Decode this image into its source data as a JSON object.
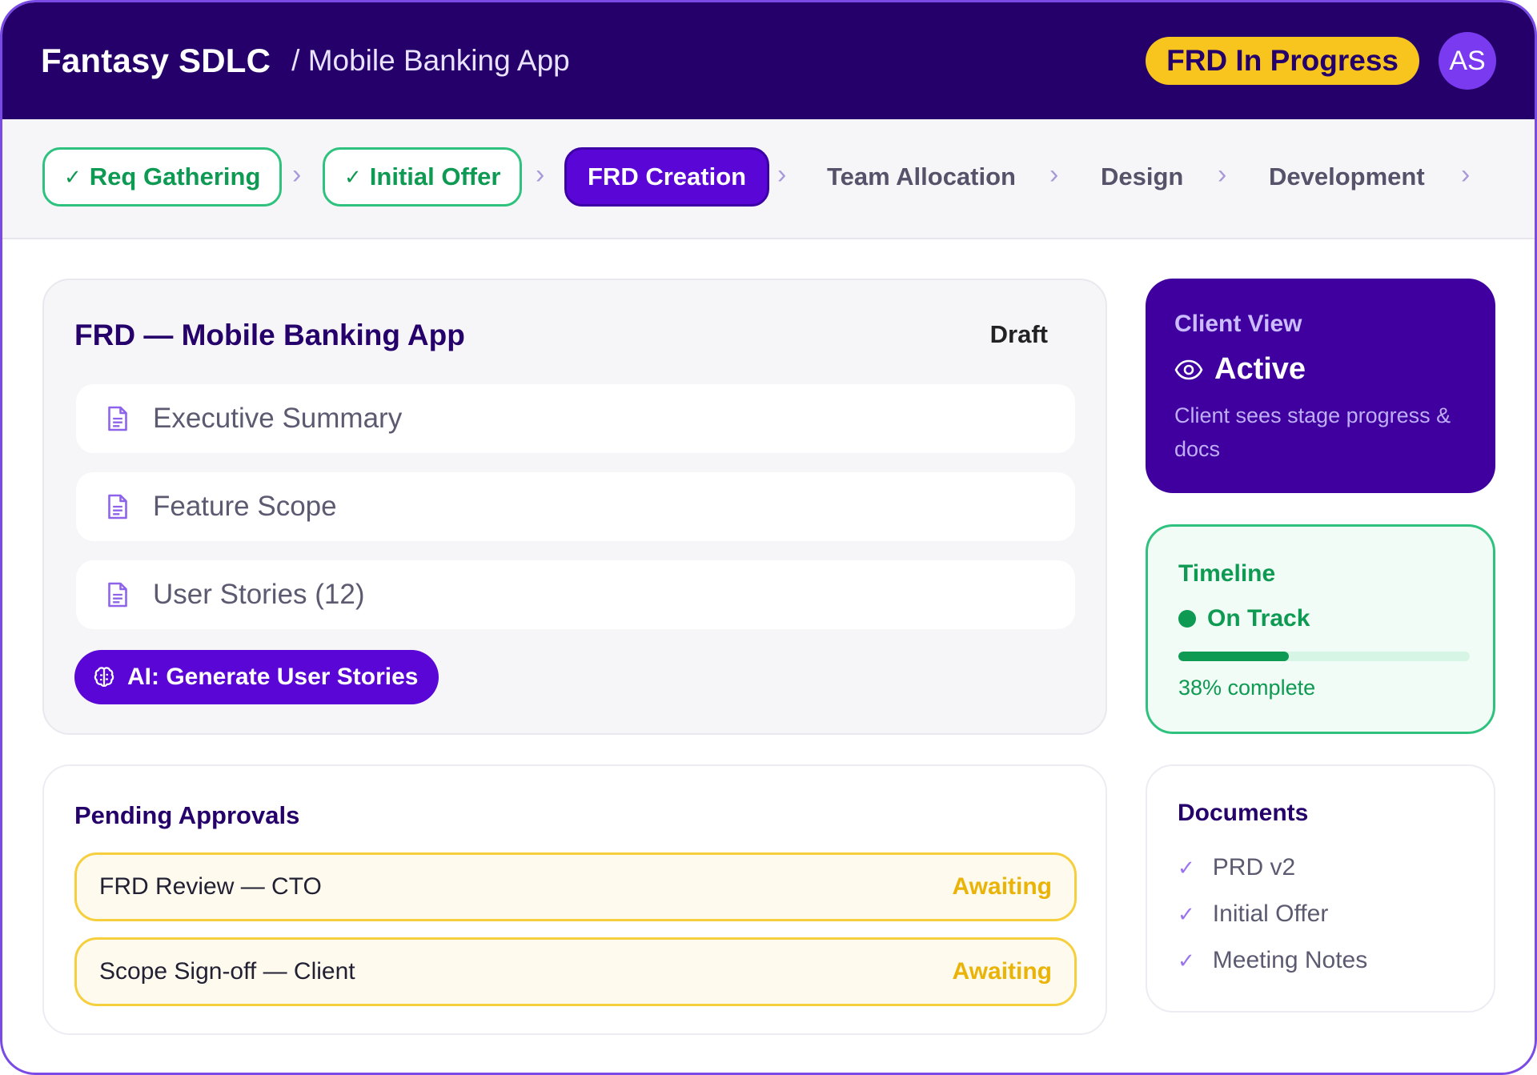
{
  "header": {
    "brand": "Fantasy SDLC",
    "breadcrumb": "/ Mobile Banking App",
    "status": "FRD In Progress",
    "avatar_initials": "AS"
  },
  "stepper": {
    "steps": [
      {
        "label": "Req Gathering",
        "state": "done"
      },
      {
        "label": "Initial Offer",
        "state": "done"
      },
      {
        "label": "FRD Creation",
        "state": "active"
      },
      {
        "label": "Team Allocation",
        "state": "todo"
      },
      {
        "label": "Design",
        "state": "todo"
      },
      {
        "label": "Development",
        "state": "todo"
      }
    ],
    "done_icon": "check-icon",
    "separator_icon": "chevron-right-icon"
  },
  "frd": {
    "title": "FRD — Mobile Banking App",
    "status": "Draft",
    "sections": [
      {
        "label": "Executive Summary",
        "icon": "document-icon"
      },
      {
        "label": "Feature Scope",
        "icon": "document-icon"
      },
      {
        "label": "User Stories (12)",
        "icon": "document-icon"
      }
    ],
    "ai_button": "AI: Generate User Stories"
  },
  "approvals": {
    "title": "Pending Approvals",
    "items": [
      {
        "label": "FRD Review — CTO",
        "state": "Awaiting"
      },
      {
        "label": "Scope Sign-off — Client",
        "state": "Awaiting"
      }
    ]
  },
  "client_view": {
    "title": "Client View",
    "status": "Active",
    "description": "Client sees stage progress & docs"
  },
  "timeline": {
    "title": "Timeline",
    "status": "On Track",
    "progress": 0.38,
    "progress_text": "38% complete"
  },
  "documents": {
    "title": "Documents",
    "items": [
      "PRD v2",
      "Initial Offer",
      "Meeting Notes"
    ]
  },
  "colors": {
    "header_bg": "#25006b",
    "accent": "#5a06d6",
    "status_yellow": "#f7c51e",
    "success": "#0e9a53",
    "awaiting": "#eab308"
  }
}
